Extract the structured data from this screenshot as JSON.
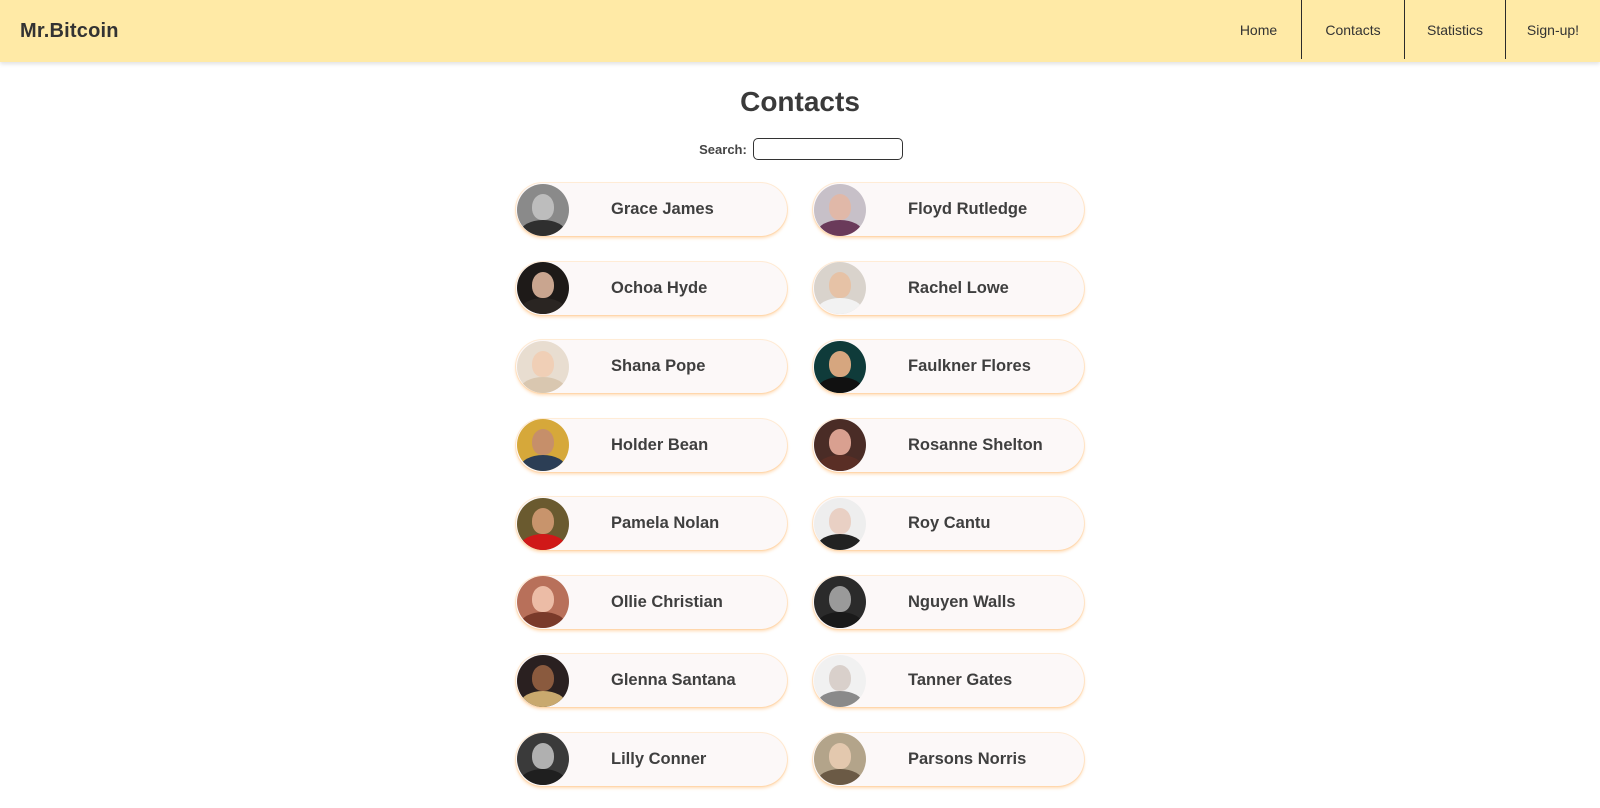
{
  "app": {
    "brand": "Mr.Bitcoin"
  },
  "nav": {
    "items": [
      {
        "label": "Home"
      },
      {
        "label": "Contacts"
      },
      {
        "label": "Statistics"
      },
      {
        "label": "Sign-up!"
      }
    ]
  },
  "page": {
    "title": "Contacts"
  },
  "search": {
    "label": "Search:",
    "value": "",
    "placeholder": ""
  },
  "colors": {
    "header_bg": "#ffeaa6",
    "card_bg": "#fcf8f8",
    "card_glow": "#ffd08a"
  },
  "contacts": [
    {
      "name": "Grace James",
      "avatar": {
        "bg": "#8a8a8a",
        "skin": "#bdbdbd",
        "shirt": "#2f2f2f"
      }
    },
    {
      "name": "Floyd Rutledge",
      "avatar": {
        "bg": "#c7c0c8",
        "skin": "#e0b8a8",
        "shirt": "#6a3a5a"
      }
    },
    {
      "name": "Ochoa Hyde",
      "avatar": {
        "bg": "#1e1a18",
        "skin": "#c9a58f",
        "shirt": "#2a2522"
      }
    },
    {
      "name": "Rachel Lowe",
      "avatar": {
        "bg": "#d9d3cc",
        "skin": "#e6c2a6",
        "shirt": "#f2f2f2"
      }
    },
    {
      "name": "Shana Pope",
      "avatar": {
        "bg": "#e8ddd0",
        "skin": "#f0cfb6",
        "shirt": "#d9c7b0"
      }
    },
    {
      "name": "Faulkner Flores",
      "avatar": {
        "bg": "#0f3b3a",
        "skin": "#d6a67f",
        "shirt": "#111111"
      }
    },
    {
      "name": "Holder Bean",
      "avatar": {
        "bg": "#d6a83a",
        "skin": "#c68f6a",
        "shirt": "#2c3e55"
      }
    },
    {
      "name": "Rosanne Shelton",
      "avatar": {
        "bg": "#4a2c26",
        "skin": "#d9a090",
        "shirt": "#5a2e25"
      }
    },
    {
      "name": "Pamela Nolan",
      "avatar": {
        "bg": "#6a5a2f",
        "skin": "#c8946c",
        "shirt": "#d01818"
      }
    },
    {
      "name": "Roy Cantu",
      "avatar": {
        "bg": "#eeeeee",
        "skin": "#e9d0c4",
        "shirt": "#222222"
      }
    },
    {
      "name": "Ollie Christian",
      "avatar": {
        "bg": "#b8705a",
        "skin": "#ecbca6",
        "shirt": "#7a3a2a"
      }
    },
    {
      "name": "Nguyen Walls",
      "avatar": {
        "bg": "#2b2b2b",
        "skin": "#9a9a9a",
        "shirt": "#1a1a1a"
      }
    },
    {
      "name": "Glenna Santana",
      "avatar": {
        "bg": "#2a2020",
        "skin": "#8a5a3e",
        "shirt": "#c9a96e"
      }
    },
    {
      "name": "Tanner Gates",
      "avatar": {
        "bg": "#f1f1f1",
        "skin": "#d9d0cb",
        "shirt": "#8a8a8a"
      }
    },
    {
      "name": "Lilly Conner",
      "avatar": {
        "bg": "#3a3a3a",
        "skin": "#b0b0b0",
        "shirt": "#1f1f1f"
      }
    },
    {
      "name": "Parsons Norris",
      "avatar": {
        "bg": "#b3a48a",
        "skin": "#e3c8ae",
        "shirt": "#6b5a45"
      }
    }
  ]
}
